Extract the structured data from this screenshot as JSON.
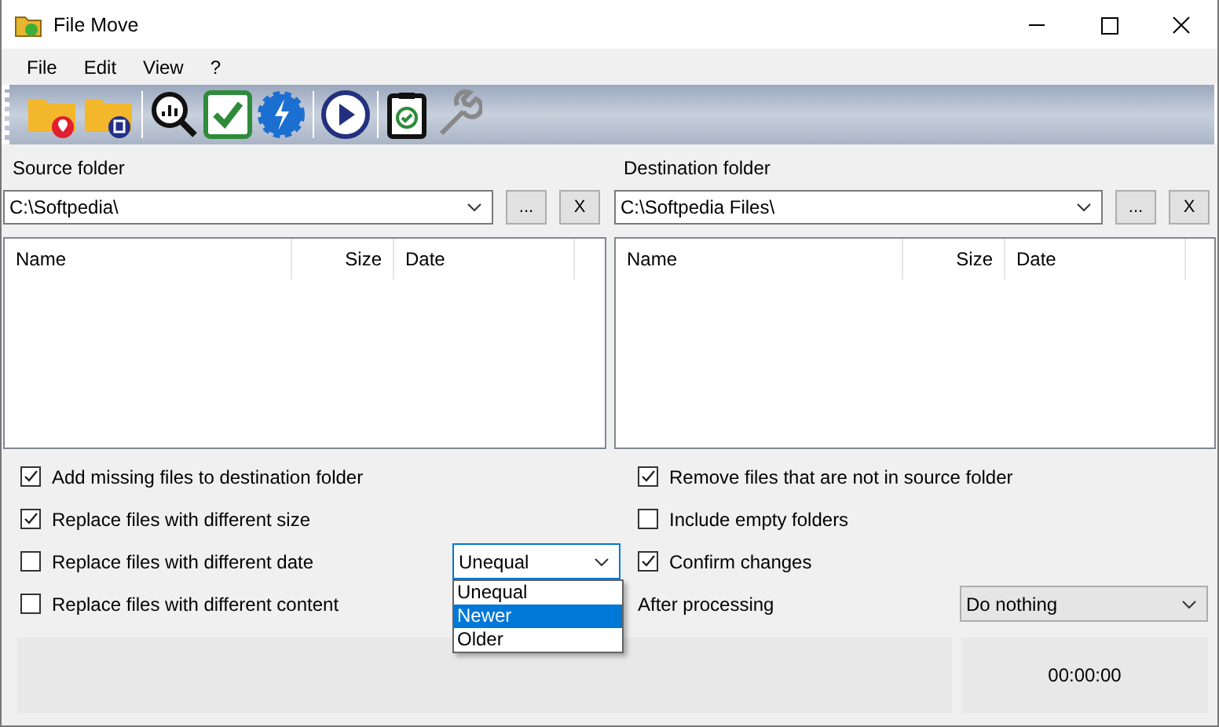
{
  "window": {
    "title": "File Move"
  },
  "menu": [
    "File",
    "Edit",
    "View",
    "?"
  ],
  "panes": [
    {
      "label": "Source folder",
      "path": "C:\\Softpedia\\",
      "browse": "...",
      "clear": "X",
      "columns": [
        "Name",
        "Size",
        "Date"
      ]
    },
    {
      "label": "Destination folder",
      "path": "C:\\Softpedia Files\\",
      "browse": "...",
      "clear": "X",
      "columns": [
        "Name",
        "Size",
        "Date"
      ]
    }
  ],
  "left_options": [
    {
      "label": "Add missing files to destination folder",
      "checked": true
    },
    {
      "label": "Replace files with different size",
      "checked": true
    },
    {
      "label": "Replace files with different date",
      "checked": false
    },
    {
      "label": "Replace files with different content",
      "checked": false
    }
  ],
  "date_compare": {
    "value": "Unequal",
    "expanded": true,
    "options": [
      {
        "label": "Unequal",
        "highlighted": false
      },
      {
        "label": "Newer",
        "highlighted": true
      },
      {
        "label": "Older",
        "highlighted": false
      }
    ]
  },
  "right_options": [
    {
      "label": "Remove files that are not in source folder",
      "checked": true
    },
    {
      "label": "Include empty folders",
      "checked": false
    },
    {
      "label": "Confirm changes",
      "checked": true
    }
  ],
  "after_processing": {
    "label": "After processing",
    "value": "Do nothing"
  },
  "status": {
    "time": "00:00:00"
  }
}
